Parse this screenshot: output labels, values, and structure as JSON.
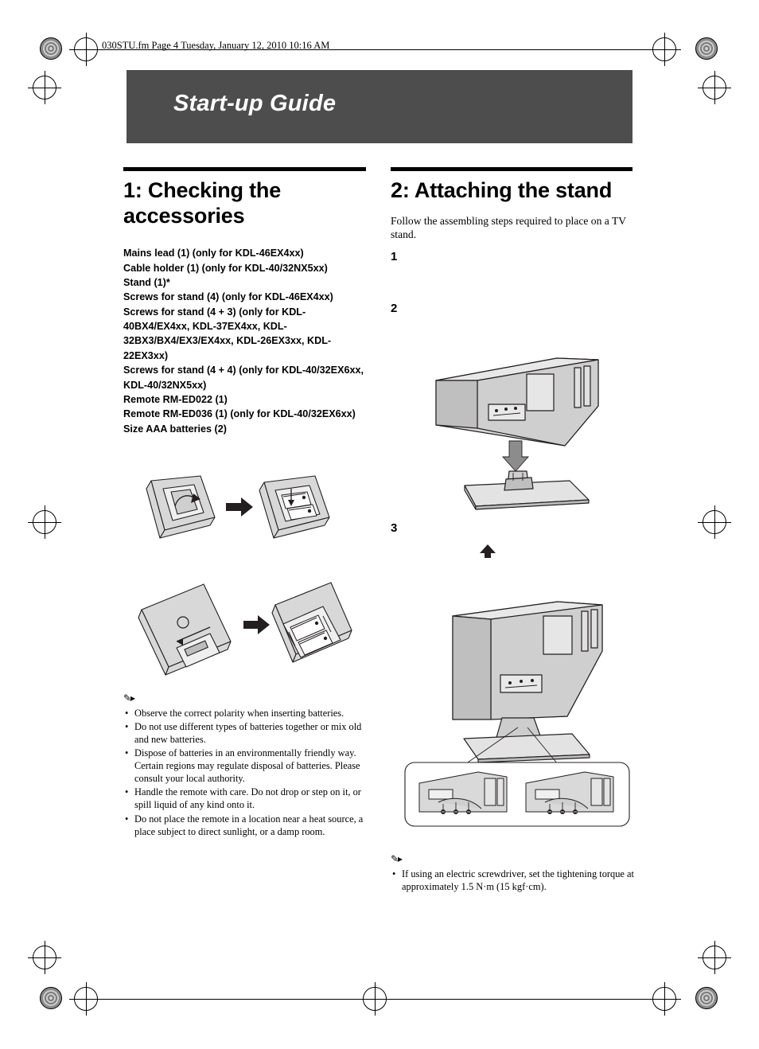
{
  "header": {
    "file_line": "030STU.fm  Page 4  Tuesday, January 12, 2010  10:16 AM"
  },
  "title": {
    "text": "Start-up Guide"
  },
  "left_column": {
    "heading": "1: Checking the accessories",
    "accessories": [
      "Mains lead (1) (only for KDL-46EX4xx)",
      "Cable holder (1) (only for KDL-40/32NX5xx)",
      "Stand (1)*",
      "Screws for stand (4) (only for KDL-46EX4xx)",
      "Screws for stand (4 + 3) (only for KDL-40BX4/EX4xx, KDL-37EX4xx, KDL-32BX3/BX4/EX3/EX4xx, KDL-26EX3xx, KDL-22EX3xx)",
      "Screws for stand (4 + 4) (only for KDL-40/32EX6xx, KDL-40/32NX5xx)",
      "Remote RM-ED022 (1)",
      "Remote RM-ED036 (1) (only for KDL-40/32EX6xx)",
      "Size AAA batteries (2)"
    ],
    "notes_icon": "note-pencil",
    "notes": [
      "Observe the correct polarity when inserting batteries.",
      "Do not use different types of batteries together or mix old and new batteries.",
      "Dispose of batteries in an environmentally friendly way. Certain regions may regulate disposal of batteries. Please consult your local authority.",
      "Handle the remote with care. Do not drop or step on it, or spill liquid of any kind onto it.",
      "Do not place the remote in a location near a heat source, a place subject to direct sunlight, or a damp room."
    ]
  },
  "right_column": {
    "heading": "2: Attaching the stand",
    "intro": "Follow the assembling steps required to place on a TV stand.",
    "steps": [
      "1",
      "2",
      "3"
    ],
    "notes_icon": "note-pencil",
    "notes": [
      "If using an electric screwdriver, set the tightening torque at approximately 1.5 N·m (15 kgf·cm)."
    ]
  },
  "figures": {
    "remote_battery_top": "remote-battery-cover-open-diagram",
    "remote_battery_bottom": "remote-battery-insert-diagram",
    "tv_stand_attach": "tv-attaching-stand-diagram",
    "tv_screw_detail": "tv-stand-screw-detail-diagram"
  },
  "colors": {
    "title_bar": "#4d4d4d",
    "title_text": "#ffffff",
    "rule": "#000000",
    "figure_fill": "#d8d8d8",
    "figure_stroke": "#231f20"
  }
}
